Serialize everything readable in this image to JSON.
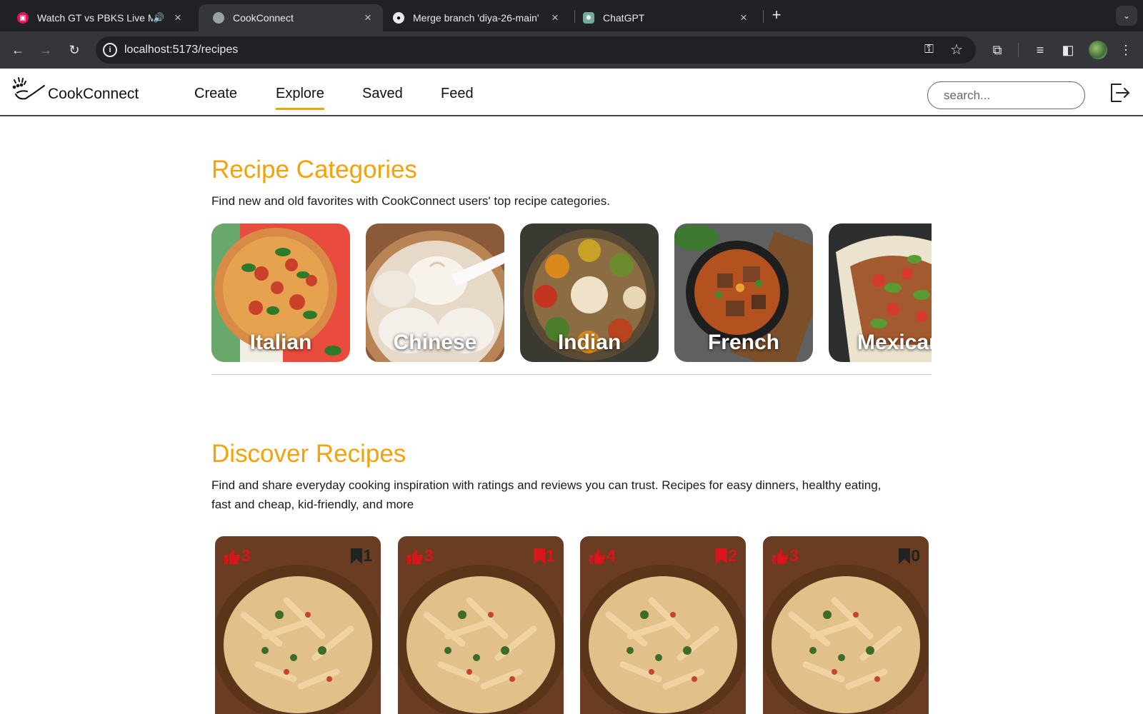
{
  "browser": {
    "tabs": [
      {
        "title": "Watch GT vs PBKS Live M",
        "favicon": "live-icon",
        "audio": true,
        "active": false
      },
      {
        "title": "CookConnect",
        "favicon": "globe-icon",
        "active": true
      },
      {
        "title": "Merge branch 'diya-26-main'",
        "favicon": "github-icon",
        "active": false
      },
      {
        "title": "ChatGPT",
        "favicon": "chatgpt-icon",
        "active": false
      }
    ],
    "url": "localhost:5173/recipes"
  },
  "app": {
    "brand": "CookConnect",
    "nav": [
      "Create",
      "Explore",
      "Saved",
      "Feed"
    ],
    "active_nav": "Explore",
    "search_placeholder": "search...",
    "accent_color": "#f5a20a"
  },
  "categories": {
    "title": "Recipe Categories",
    "subtitle": "Find new and old favorites with CookConnect users' top recipe categories.",
    "items": [
      "Italian",
      "Chinese",
      "Indian",
      "French",
      "Mexican"
    ]
  },
  "discover": {
    "title": "Discover Recipes",
    "subtitle_line1": "Find and share everyday cooking inspiration with ratings and reviews you can trust. Recipes for easy dinners, healthy eating,",
    "subtitle_line2": "fast and cheap, kid-friendly, and more",
    "cards": [
      {
        "likes": "3",
        "saves": "1",
        "saved": false
      },
      {
        "likes": "3",
        "saves": "1",
        "saved": true
      },
      {
        "likes": "4",
        "saves": "2",
        "saved": true
      },
      {
        "likes": "3",
        "saves": "0",
        "saved": false
      }
    ]
  }
}
